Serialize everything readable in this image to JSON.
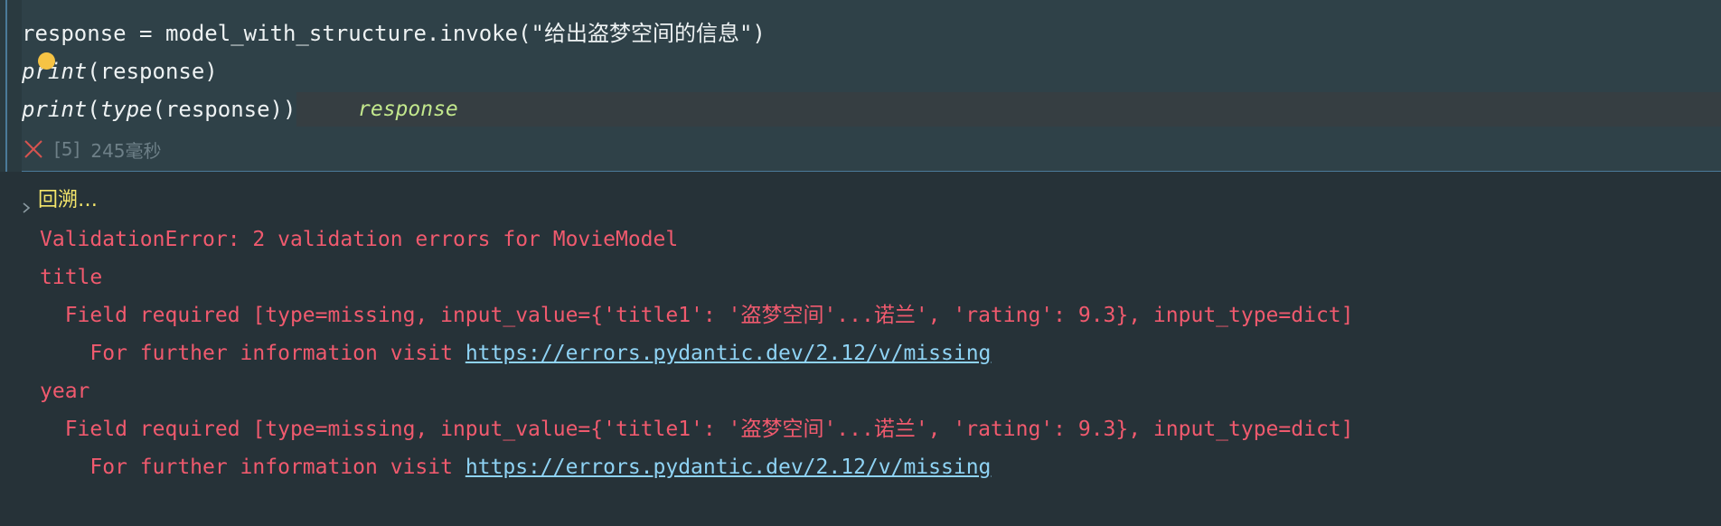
{
  "cell": {
    "code": {
      "line1": "response = model_with_structure.invoke(\"给出盗梦空间的信息\")",
      "line2_fn": "print",
      "line2_rest": "(response)",
      "line3_fn": "print",
      "line3_open": "(",
      "line3_type": "type",
      "line3_rest": "(response))",
      "inline_hint": "response"
    },
    "exec_count": "[5]",
    "duration": "245毫秒",
    "status": "error"
  },
  "output": {
    "traceback_label": "回溯…",
    "lines": [
      "ValidationError: 2 validation errors for MovieModel",
      "title",
      "  Field required [type=missing, input_value={'title1': '盗梦空间'...诺兰', 'rating': 9.3}, input_type=dict]",
      "    For further information visit ",
      "year",
      "  Field required [type=missing, input_value={'title1': '盗梦空间'...诺兰', 'rating': 9.3}, input_type=dict]",
      "    For further information visit "
    ],
    "link_text": "https://errors.pydantic.dev/2.12/v/missing"
  },
  "colors": {
    "background": "#263238",
    "cell_background": "#2f4148",
    "error_text": "#f05a6e",
    "link": "#8fd3f4",
    "traceback_label": "#f4e66b",
    "inline_hint": "#c3e88d",
    "breakpoint": "#f6c344"
  },
  "icons": {
    "status": "close-icon",
    "traceback_toggle": "chevron-right-icon"
  }
}
